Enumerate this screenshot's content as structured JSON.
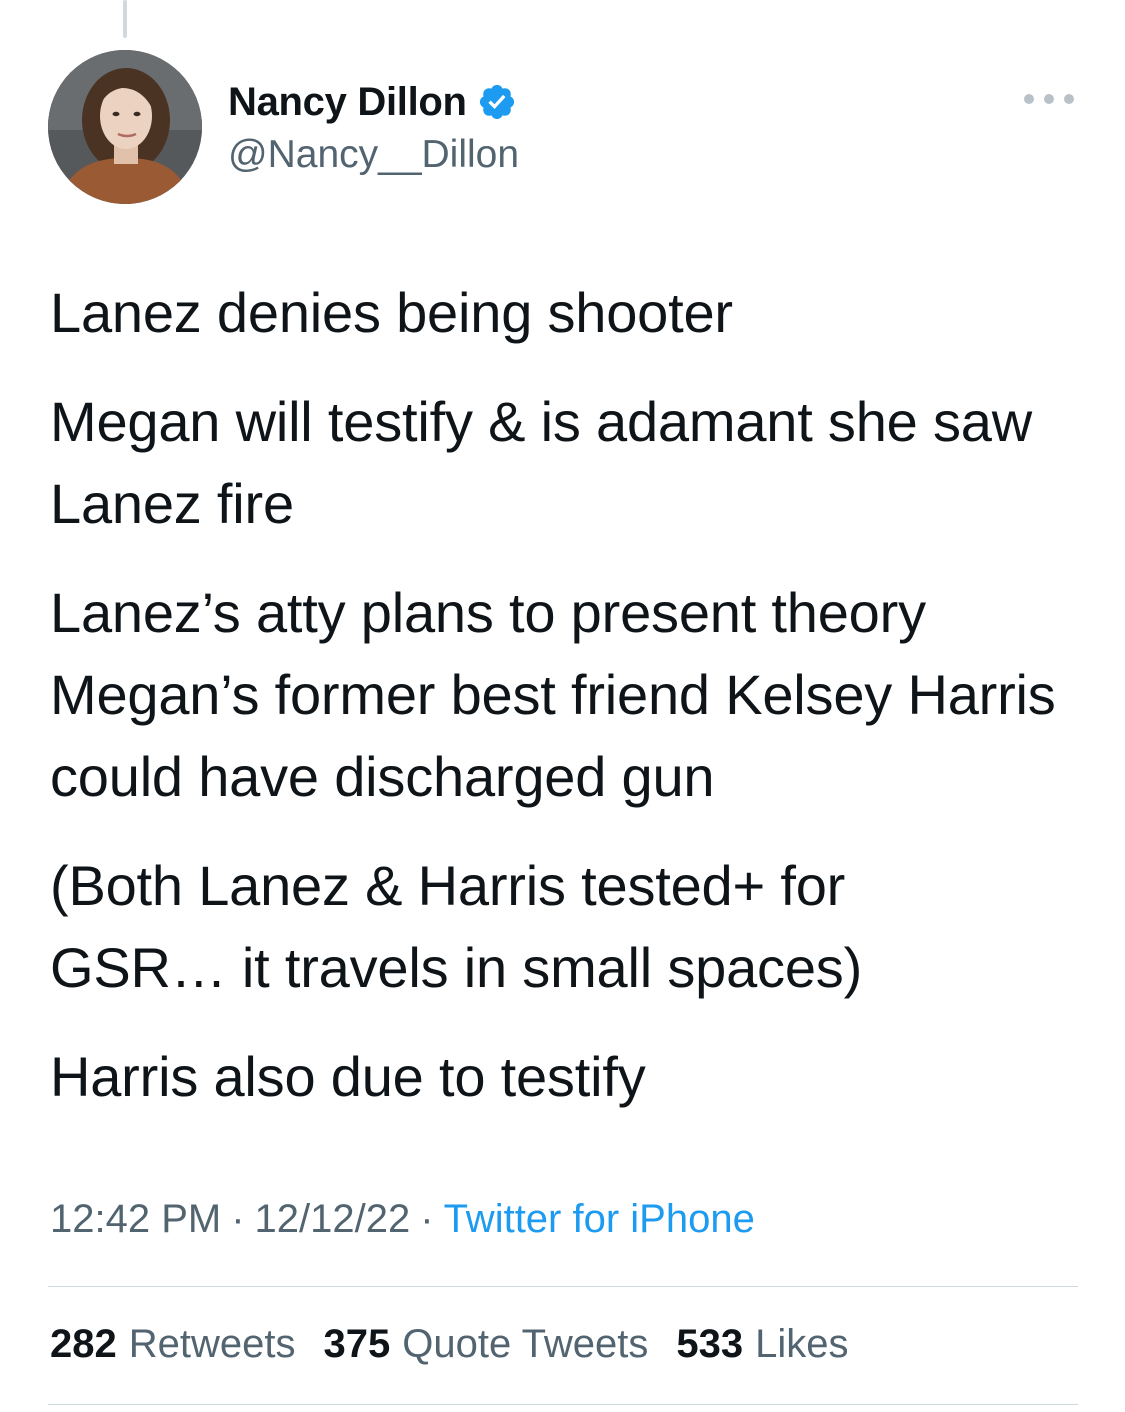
{
  "author": {
    "display_name": "Nancy Dillon",
    "handle": "@Nancy__Dillon",
    "verified": true,
    "verified_color": "#1d9bf0"
  },
  "tweet": {
    "paragraphs": [
      "Lanez denies being shooter",
      "Megan will testify & is adamant she saw Lanez fire",
      "Lanez’s atty plans to present theory Megan’s former best friend Kelsey Harris could have discharged gun",
      "(Both Lanez & Harris tested+ for GSR… it travels in small spaces)",
      "Harris also due to testify"
    ],
    "time": "12:42 PM",
    "date": "12/12/22",
    "source": "Twitter for iPhone",
    "separator": "·"
  },
  "stats": {
    "retweets": {
      "count": "282",
      "label": "Retweets"
    },
    "quotes": {
      "count": "375",
      "label": "Quote Tweets"
    },
    "likes": {
      "count": "533",
      "label": "Likes"
    }
  },
  "icons": {
    "verified": "verified-badge-icon",
    "more": "more-options-icon"
  },
  "colors": {
    "text_primary": "#0f1419",
    "text_secondary": "#536471",
    "link": "#1d9bf0",
    "divider": "#cfd9de"
  }
}
